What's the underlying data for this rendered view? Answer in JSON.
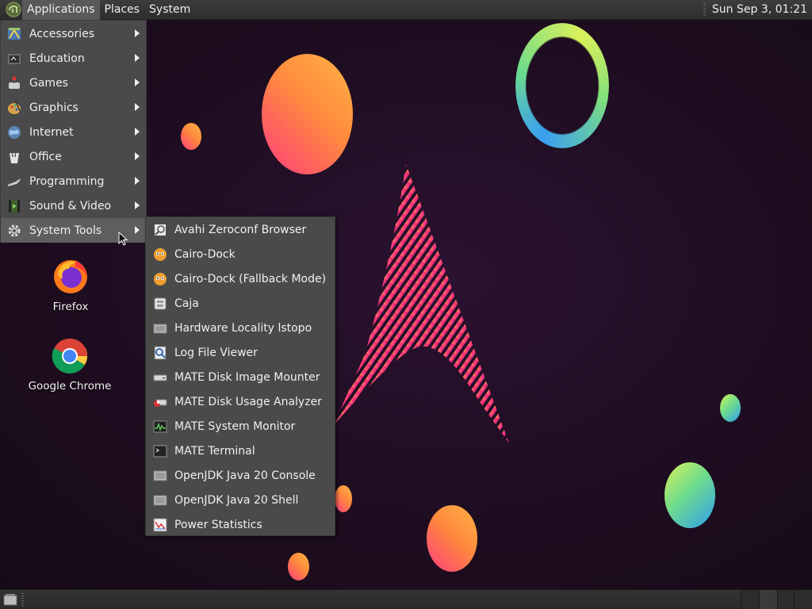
{
  "top_panel": {
    "menus": [
      "Applications",
      "Places",
      "System"
    ],
    "clock": "Sun Sep  3, 01:21"
  },
  "app_menu": {
    "items": [
      {
        "label": "Accessories",
        "icon": "accessories-icon"
      },
      {
        "label": "Education",
        "icon": "education-icon"
      },
      {
        "label": "Games",
        "icon": "games-icon"
      },
      {
        "label": "Graphics",
        "icon": "graphics-icon"
      },
      {
        "label": "Internet",
        "icon": "internet-icon"
      },
      {
        "label": "Office",
        "icon": "office-icon"
      },
      {
        "label": "Programming",
        "icon": "programming-icon"
      },
      {
        "label": "Sound & Video",
        "icon": "sound-video-icon"
      },
      {
        "label": "System Tools",
        "icon": "system-tools-icon"
      }
    ],
    "highlighted": "System Tools"
  },
  "system_tools_submenu": {
    "items": [
      {
        "label": "Avahi Zeroconf Browser",
        "icon": "avahi-icon"
      },
      {
        "label": "Cairo-Dock",
        "icon": "cairo-dock-icon"
      },
      {
        "label": "Cairo-Dock (Fallback Mode)",
        "icon": "cairo-dock-icon"
      },
      {
        "label": "Caja",
        "icon": "caja-icon"
      },
      {
        "label": "Hardware Locality lstopo",
        "icon": "hardware-icon"
      },
      {
        "label": "Log File Viewer",
        "icon": "log-viewer-icon"
      },
      {
        "label": "MATE Disk Image Mounter",
        "icon": "disk-mounter-icon"
      },
      {
        "label": "MATE Disk Usage Analyzer",
        "icon": "disk-usage-icon"
      },
      {
        "label": "MATE System Monitor",
        "icon": "system-monitor-icon"
      },
      {
        "label": "MATE Terminal",
        "icon": "terminal-icon"
      },
      {
        "label": "OpenJDK Java 20 Console",
        "icon": "java-console-icon"
      },
      {
        "label": "OpenJDK Java 20 Shell",
        "icon": "java-shell-icon"
      },
      {
        "label": "Power Statistics",
        "icon": "power-statistics-icon"
      }
    ]
  },
  "desktop_icons": [
    {
      "label": "Firefox",
      "icon": "firefox-icon"
    },
    {
      "label": "Google Chrome",
      "icon": "chrome-icon"
    }
  ],
  "colors": {
    "panel": "#333333",
    "menu_bg": "#4a4a4a",
    "menu_highlight": "#5e5e5e",
    "desktop_bg": "#1e0d20",
    "warm_accent": "#ff8a3d",
    "pink_accent": "#ff3d7f",
    "cool_accent": "#2f9df0"
  }
}
